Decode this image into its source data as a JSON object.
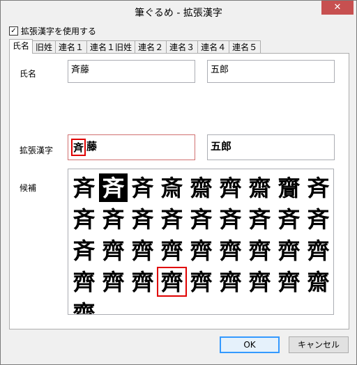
{
  "window": {
    "title": "筆ぐるめ - 拡張漢字",
    "close_glyph": "✕"
  },
  "use_extended": {
    "label": "拡張漢字を使用する",
    "checked": true,
    "check_glyph": "✓"
  },
  "tabs": [
    {
      "label": "氏名",
      "active": true
    },
    {
      "label": "旧姓",
      "active": false
    },
    {
      "label": "連名１",
      "active": false
    },
    {
      "label": "連名１旧姓",
      "active": false
    },
    {
      "label": "連名２",
      "active": false
    },
    {
      "label": "連名３",
      "active": false
    },
    {
      "label": "連名４",
      "active": false
    },
    {
      "label": "連名５",
      "active": false
    }
  ],
  "name": {
    "label": "氏名",
    "surname": "斉藤",
    "given": "五郎"
  },
  "extended": {
    "label": "拡張漢字",
    "surname_first": "斉",
    "surname_rest": "藤",
    "given": "五郎"
  },
  "candidates": {
    "label": "候補",
    "rows": [
      [
        "斉",
        "斉",
        "斉",
        "斎",
        "齋",
        "齊",
        "齋",
        "齎",
        "斉"
      ],
      [
        "斉",
        "斉",
        "斉",
        "斉",
        "斉",
        "斉",
        "斉",
        "斉",
        "斉"
      ],
      [
        "斉",
        "齊",
        "齊",
        "齊",
        "齊",
        "齊",
        "齊",
        "齊",
        "齊"
      ],
      [
        "齊",
        "齊",
        "齊",
        "齊",
        "齊",
        "齊",
        "齊",
        "齊",
        "齋"
      ],
      [
        "齋"
      ]
    ],
    "selected_index": 1,
    "boxed": {
      "row": 3,
      "col": 3
    }
  },
  "buttons": {
    "ok": "OK",
    "cancel": "キャンセル"
  }
}
